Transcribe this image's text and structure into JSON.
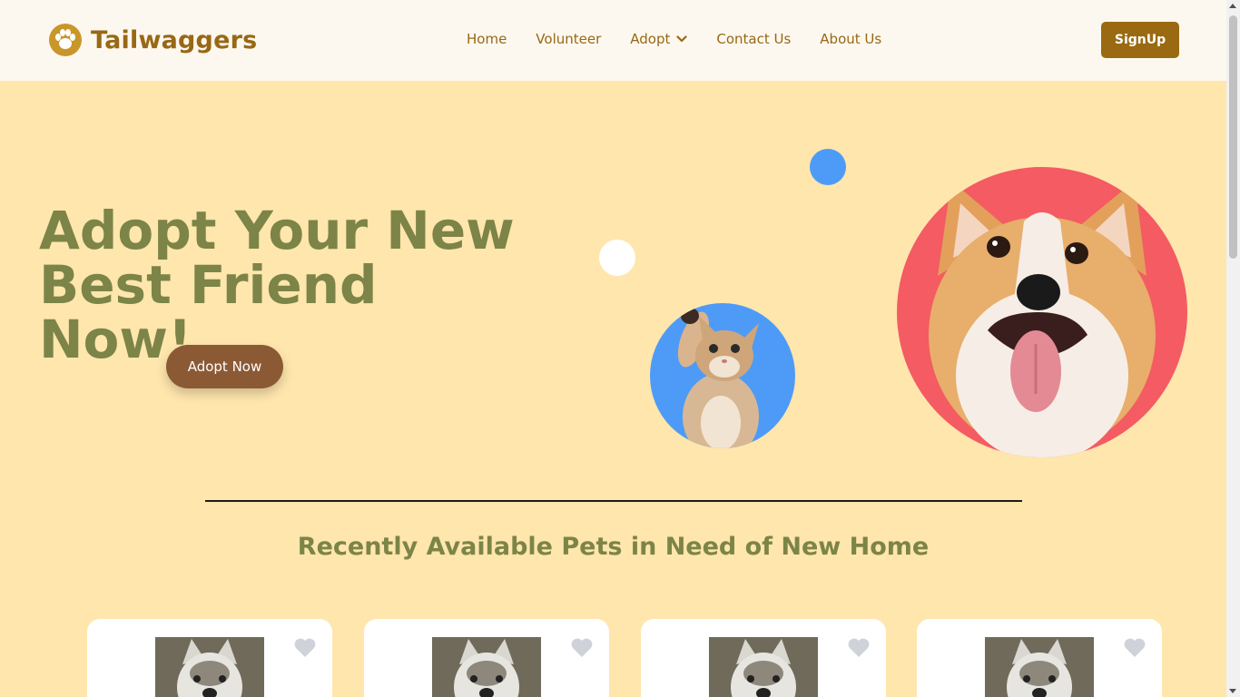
{
  "header": {
    "brand": "Tailwaggers",
    "brand_icon": "paw-icon",
    "nav": [
      {
        "label": "Home"
      },
      {
        "label": "Volunteer"
      },
      {
        "label": "Adopt",
        "icon": "chevron-down-icon"
      },
      {
        "label": "Contact Us"
      },
      {
        "label": "About Us"
      }
    ],
    "signup_label": "SignUp"
  },
  "hero": {
    "title_line1": "Adopt Your New",
    "title_line2": "Best Friend Now!",
    "cta_label": "Adopt Now"
  },
  "section": {
    "title": "Recently Available Pets in Need of New Home"
  },
  "pets": [
    {
      "image": "husky-photo",
      "favorite_icon": "heart-icon"
    },
    {
      "image": "husky-photo",
      "favorite_icon": "heart-icon"
    },
    {
      "image": "husky-photo",
      "favorite_icon": "heart-icon"
    },
    {
      "image": "husky-photo",
      "favorite_icon": "heart-icon"
    }
  ],
  "colors": {
    "background": "#ffe6ad",
    "header_bg": "#fdf8ef",
    "brand": "#986815",
    "title": "#7c8447",
    "signup_bg": "#9a6a12",
    "cta_bg": "#8b5a35",
    "accent_blue": "#4d9bf7",
    "accent_red": "#f45b62"
  }
}
